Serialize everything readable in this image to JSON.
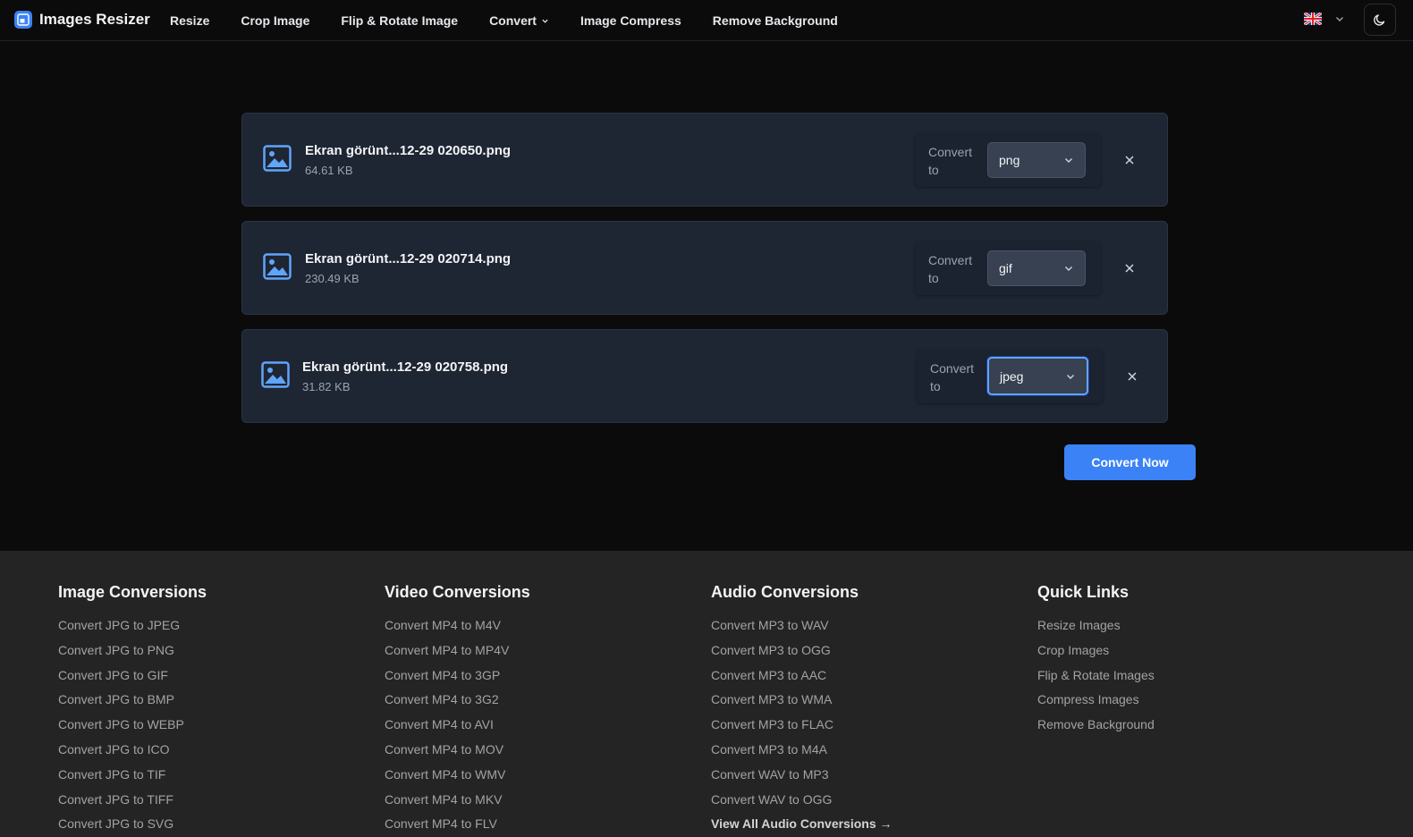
{
  "header": {
    "brand": "Images Resizer",
    "nav": [
      {
        "label": "Resize"
      },
      {
        "label": "Crop Image"
      },
      {
        "label": "Flip & Rotate Image"
      },
      {
        "label": "Convert",
        "has_dropdown": true
      },
      {
        "label": "Image Compress"
      },
      {
        "label": "Remove Background"
      }
    ],
    "language_icon": "uk-flag-icon",
    "theme_icon": "moon-icon"
  },
  "files": [
    {
      "name": "Ekran görünt...12-29 020650.png",
      "size": "64.61 KB",
      "convert_label": "Convert to",
      "format": "png",
      "focused": false
    },
    {
      "name": "Ekran görünt...12-29 020714.png",
      "size": "230.49 KB",
      "convert_label": "Convert to",
      "format": "gif",
      "focused": false
    },
    {
      "name": "Ekran görünt...12-29 020758.png",
      "size": "31.82 KB",
      "convert_label": "Convert to",
      "format": "jpeg",
      "focused": true
    }
  ],
  "convert_button": "Convert Now",
  "footer": {
    "columns": [
      {
        "title": "Image Conversions",
        "links": [
          "Convert JPG to JPEG",
          "Convert JPG to PNG",
          "Convert JPG to GIF",
          "Convert JPG to BMP",
          "Convert JPG to WEBP",
          "Convert JPG to ICO",
          "Convert JPG to TIF",
          "Convert JPG to TIFF",
          "Convert JPG to SVG"
        ]
      },
      {
        "title": "Video Conversions",
        "links": [
          "Convert MP4 to M4V",
          "Convert MP4 to MP4V",
          "Convert MP4 to 3GP",
          "Convert MP4 to 3G2",
          "Convert MP4 to AVI",
          "Convert MP4 to MOV",
          "Convert MP4 to WMV",
          "Convert MP4 to MKV",
          "Convert MP4 to FLV"
        ]
      },
      {
        "title": "Audio Conversions",
        "links": [
          "Convert MP3 to WAV",
          "Convert MP3 to OGG",
          "Convert MP3 to AAC",
          "Convert MP3 to WMA",
          "Convert MP3 to FLAC",
          "Convert MP3 to M4A",
          "Convert WAV to MP3",
          "Convert WAV to OGG"
        ],
        "view_all": "View All Audio Conversions →"
      },
      {
        "title": "Quick Links",
        "links": [
          "Resize Images",
          "Crop Images",
          "Flip & Rotate Images",
          "Compress Images",
          "Remove Background"
        ]
      }
    ]
  },
  "colors": {
    "accent": "#3b82f6",
    "card": "#1e2533",
    "footer": "#242424",
    "icon": "#60a5fa"
  }
}
